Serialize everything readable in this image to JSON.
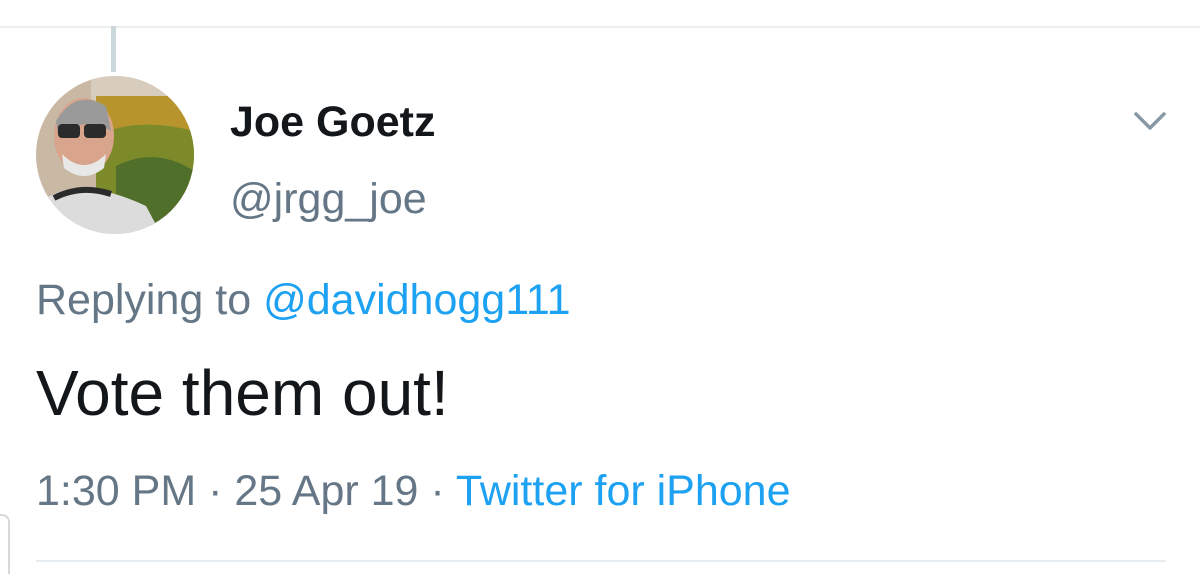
{
  "tweet": {
    "author": {
      "display_name": "Joe Goetz",
      "handle": "@jrgg_joe",
      "avatar": "profile-photo"
    },
    "reply": {
      "prefix": "Replying to",
      "mention": "@davidhogg111"
    },
    "text": "Vote them out!",
    "meta": {
      "time": "1:30 PM",
      "separator": "·",
      "date": "25 Apr 19",
      "source": "Twitter for iPhone"
    },
    "menu_icon": "chevron-down-icon"
  },
  "colors": {
    "link": "#1da1f2",
    "secondary_text": "#657786",
    "primary_text": "#14171a",
    "thread_line": "#ccd6dd"
  }
}
